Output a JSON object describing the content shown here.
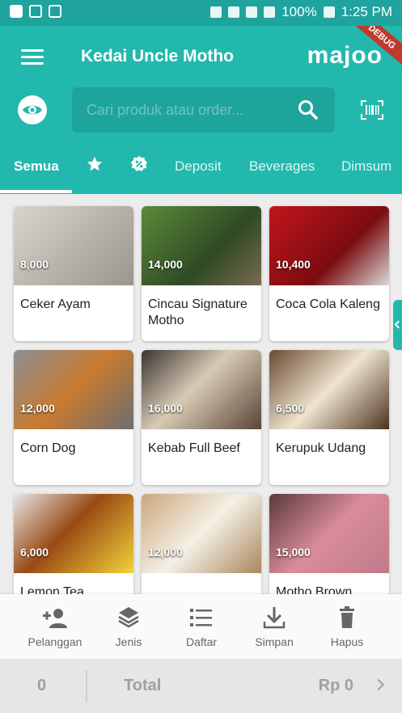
{
  "status": {
    "battery": "100%",
    "time": "1:25 PM"
  },
  "header": {
    "title": "Kedai Uncle Motho",
    "logo": "majoo",
    "ribbon": "DEBUG"
  },
  "search": {
    "placeholder": "Cari produk atau order..."
  },
  "tabs": [
    "Semua",
    "Deposit",
    "Beverages",
    "Dimsum"
  ],
  "products": [
    {
      "price": "8,000",
      "name": "Ceker Ayam"
    },
    {
      "price": "14,000",
      "name": "Cincau Signature Motho"
    },
    {
      "price": "10,400",
      "name": "Coca Cola Kaleng"
    },
    {
      "price": "12,000",
      "name": "Corn Dog"
    },
    {
      "price": "16,000",
      "name": "Kebab Full Beef"
    },
    {
      "price": "6,500",
      "name": "Kerupuk Udang"
    },
    {
      "price": "6,000",
      "name": "Lemon Tea"
    },
    {
      "price": "12,000",
      "name": ""
    },
    {
      "price": "15,000",
      "name": "Motho Brown"
    }
  ],
  "toolbar": {
    "pelanggan": "Pelanggan",
    "jenis": "Jenis",
    "daftar": "Daftar",
    "simpan": "Simpan",
    "hapus": "Hapus"
  },
  "totals": {
    "qty": "0",
    "label": "Total",
    "amount": "Rp 0"
  },
  "colors": {
    "primary": "#23b8ad",
    "statusbar": "#1fa39e",
    "ribbon": "#c0392b"
  }
}
